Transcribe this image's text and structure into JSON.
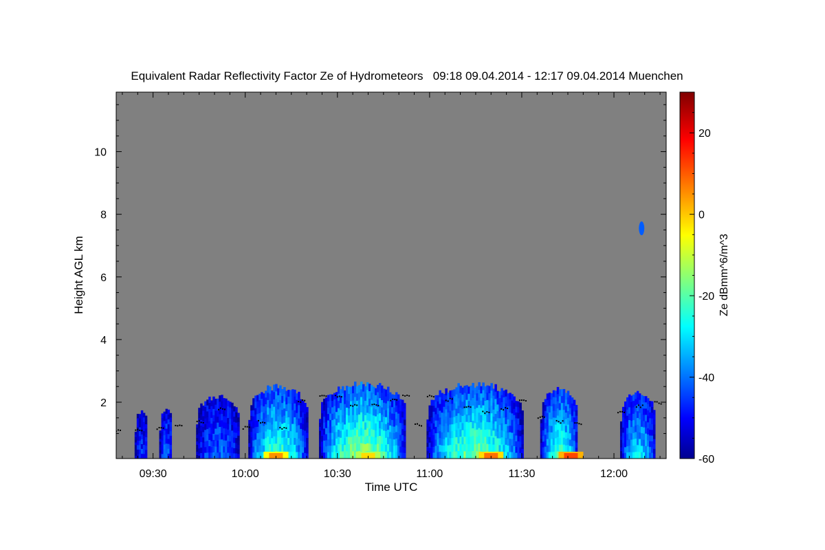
{
  "chart_data": {
    "type": "heatmap",
    "title": "Equivalent Radar Reflectivity Factor Ze of Hydrometeors   09:18 09.04.2014 - 12:17 09.04.2014 Muenchen",
    "xlabel": "Time UTC",
    "ylabel": "Height AGL km",
    "colorbar_label": "Ze dBmm^6/m^3",
    "xlim": [
      "09:18",
      "12:17"
    ],
    "ylim": [
      0.2,
      11.9
    ],
    "colorbar_range": [
      -60,
      30
    ],
    "x_ticks": [
      "09:30",
      "10:00",
      "10:30",
      "11:00",
      "11:30",
      "12:00"
    ],
    "y_ticks": [
      "2",
      "4",
      "6",
      "8",
      "10"
    ],
    "colorbar_ticks": [
      "-60",
      "-40",
      "-20",
      "0",
      "20"
    ],
    "background_color": "#808080",
    "cloud_cells": [
      {
        "start": "09:24",
        "end": "09:28",
        "top_km": 1.8,
        "ze_core": -45
      },
      {
        "start": "09:32",
        "end": "09:36",
        "top_km": 1.9,
        "ze_core": -40
      },
      {
        "start": "09:44",
        "end": "09:58",
        "top_km": 2.3,
        "ze_core": -40
      },
      {
        "start": "10:01",
        "end": "10:20",
        "top_km": 2.6,
        "ze_core": -20
      },
      {
        "start": "10:24",
        "end": "10:52",
        "top_km": 2.7,
        "ze_core": -12
      },
      {
        "start": "10:59",
        "end": "11:30",
        "top_km": 2.7,
        "ze_core": -15
      },
      {
        "start": "11:36",
        "end": "11:48",
        "top_km": 2.5,
        "ze_core": -20
      },
      {
        "start": "12:02",
        "end": "12:13",
        "top_km": 2.4,
        "ze_core": -28
      },
      {
        "start": "12:09",
        "end": "12:09",
        "top_km": 7.7,
        "ze_core": -42
      }
    ],
    "near_surface_max": [
      {
        "time": "10:10",
        "ze": 5
      },
      {
        "time": "10:40",
        "ze": -2
      },
      {
        "time": "11:20",
        "ze": 8
      },
      {
        "time": "11:46",
        "ze": 12
      }
    ],
    "cloud_base_points": [
      {
        "time": "09:18",
        "km": 1.1
      },
      {
        "time": "09:25",
        "km": 1.15
      },
      {
        "time": "09:32",
        "km": 1.2
      },
      {
        "time": "09:38",
        "km": 1.25
      },
      {
        "time": "09:45",
        "km": 1.4
      },
      {
        "time": "09:52",
        "km": 1.8
      },
      {
        "time": "10:00",
        "km": 1.2
      },
      {
        "time": "10:05",
        "km": 1.4
      },
      {
        "time": "10:12",
        "km": 1.2
      },
      {
        "time": "10:18",
        "km": 2.05
      },
      {
        "time": "10:25",
        "km": 2.25
      },
      {
        "time": "10:30",
        "km": 2.2
      },
      {
        "time": "10:35",
        "km": 1.9
      },
      {
        "time": "10:42",
        "km": 1.95
      },
      {
        "time": "10:48",
        "km": 2.1
      },
      {
        "time": "10:52",
        "km": 2.2
      },
      {
        "time": "10:56",
        "km": 1.3
      },
      {
        "time": "11:00",
        "km": 2.2
      },
      {
        "time": "11:06",
        "km": 2.1
      },
      {
        "time": "11:12",
        "km": 1.9
      },
      {
        "time": "11:18",
        "km": 1.7
      },
      {
        "time": "11:24",
        "km": 1.8
      },
      {
        "time": "11:30",
        "km": 2.1
      },
      {
        "time": "11:36",
        "km": 1.55
      },
      {
        "time": "11:42",
        "km": 1.4
      },
      {
        "time": "11:48",
        "km": 1.35
      },
      {
        "time": "12:02",
        "km": 1.7
      },
      {
        "time": "12:08",
        "km": 1.9
      },
      {
        "time": "12:14",
        "km": 2.0
      }
    ]
  }
}
